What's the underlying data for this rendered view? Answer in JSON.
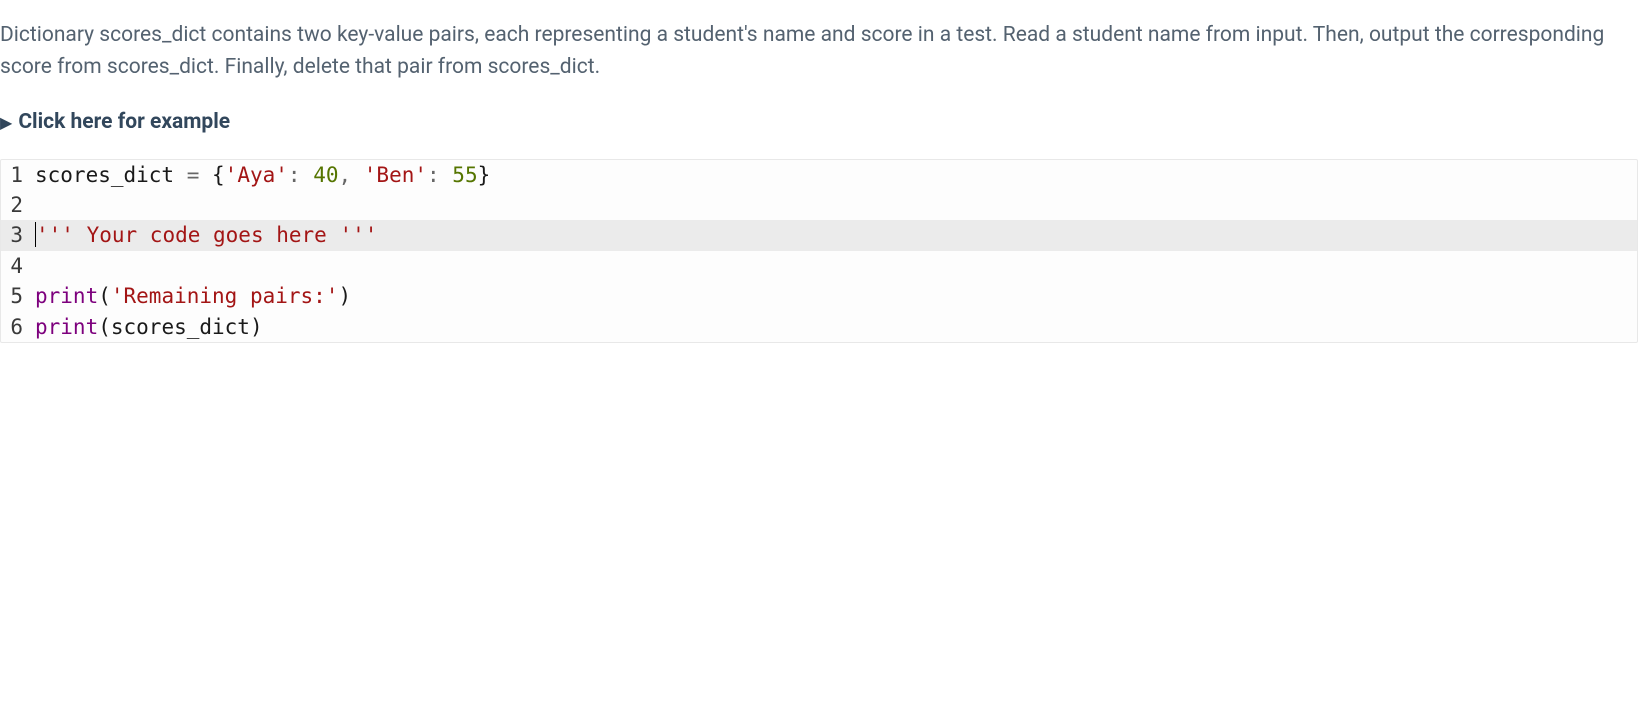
{
  "problem": {
    "description": "Dictionary scores_dict contains two key-value pairs, each representing a student's name and score in a test. Read a student name from input. Then, output the corresponding score from scores_dict. Finally, delete that pair from scores_dict."
  },
  "example_toggle": {
    "icon": "▶",
    "label": "Click here for example"
  },
  "code": {
    "lines": {
      "n1": "1",
      "n2": "2",
      "n3": "3",
      "n4": "4",
      "n5": "5",
      "n6": "6"
    },
    "line1": {
      "var": "scores_dict",
      "eq": " = ",
      "lbrace": "{",
      "k1": "'Aya'",
      "c1": ": ",
      "v1": "40",
      "comma": ", ",
      "k2": "'Ben'",
      "c2": ": ",
      "v2": "55",
      "rbrace": "}"
    },
    "line3": {
      "open": "'''",
      "body": " Your code goes here ",
      "close": "'''"
    },
    "line5": {
      "fn": "print",
      "lp": "(",
      "arg": "'Remaining pairs:'",
      "rp": ")"
    },
    "line6": {
      "fn": "print",
      "lp": "(",
      "arg": "scores_dict",
      "rp": ")"
    }
  }
}
